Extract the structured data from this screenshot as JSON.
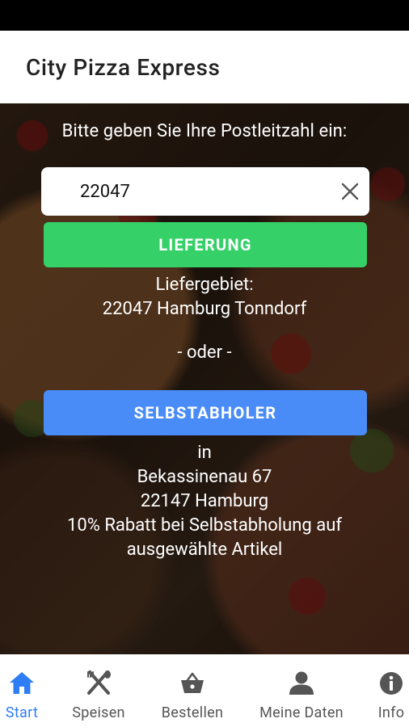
{
  "app": {
    "title": "City Pizza Express"
  },
  "main": {
    "prompt": "Bitte geben Sie Ihre Postleitzahl ein:",
    "zip_value": "22047",
    "delivery_button": "LIEFERUNG",
    "delivery_area_label": "Liefergebiet:",
    "delivery_area_value": "22047 Hamburg Tonndorf",
    "or_text": "- oder -",
    "pickup_button": "SELBSTABHOLER",
    "pickup_in": "in",
    "pickup_street": "Bekassinenau 67",
    "pickup_city": "22147 Hamburg",
    "discount_line1": "10% Rabatt bei Selbstabholung auf",
    "discount_line2": "ausgewählte Artikel"
  },
  "nav": {
    "items": [
      {
        "label": "Start",
        "icon": "home-icon",
        "active": true
      },
      {
        "label": "Speisen",
        "icon": "cutlery-icon"
      },
      {
        "label": "Bestellen",
        "icon": "basket-icon"
      },
      {
        "label": "Meine Daten",
        "icon": "person-icon"
      },
      {
        "label": "Info",
        "icon": "info-icon"
      }
    ]
  },
  "colors": {
    "delivery": "#35d068",
    "pickup": "#4a8cf7",
    "nav_active": "#2f7df5",
    "nav_inactive": "#555555"
  }
}
